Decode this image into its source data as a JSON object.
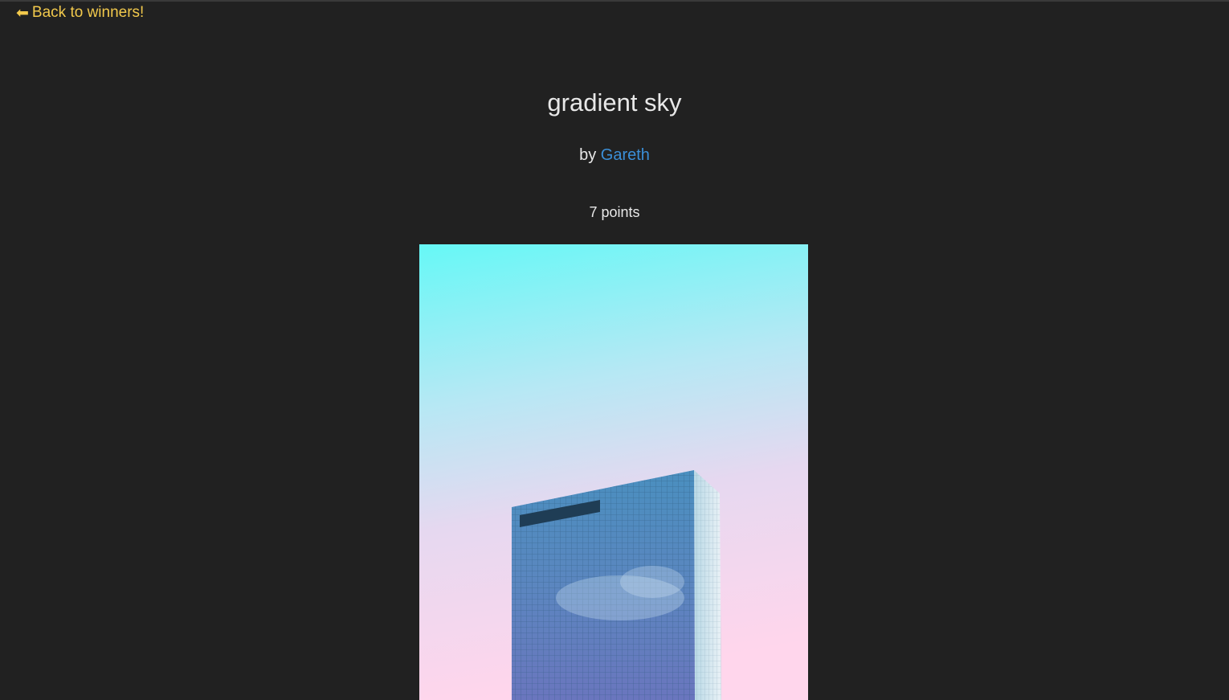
{
  "nav": {
    "back_label": "Back to winners!",
    "back_icon": "left-arrow-icon"
  },
  "entry": {
    "title": "gradient sky",
    "by_prefix": "by",
    "author": "Gareth",
    "points": "7 points",
    "image_subject": "glass skyscraper against cyan-to-pink gradient sky"
  },
  "colors": {
    "background": "#212121",
    "back_link": "#f2c94c",
    "author_link": "#3b8fd8",
    "text": "#e8e8e8",
    "sky_top": "#66f8f6",
    "sky_bottom": "#ffd6ec"
  }
}
